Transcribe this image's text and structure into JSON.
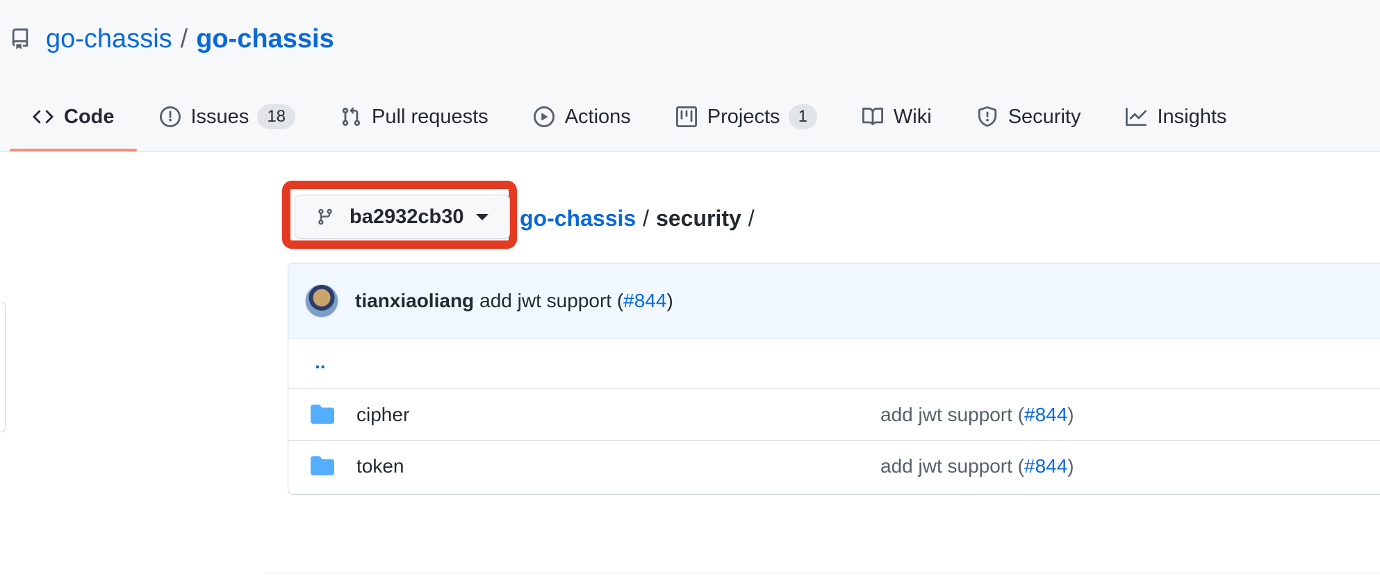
{
  "repo": {
    "owner": "go-chassis",
    "separator": "/",
    "name": "go-chassis"
  },
  "tabs": [
    {
      "label": "Code",
      "icon": "code-icon",
      "selected": true
    },
    {
      "label": "Issues",
      "icon": "issue-icon",
      "counter": "18"
    },
    {
      "label": "Pull requests",
      "icon": "pull-request-icon"
    },
    {
      "label": "Actions",
      "icon": "play-icon"
    },
    {
      "label": "Projects",
      "icon": "project-icon",
      "counter": "1"
    },
    {
      "label": "Wiki",
      "icon": "book-icon"
    },
    {
      "label": "Security",
      "icon": "shield-icon"
    },
    {
      "label": "Insights",
      "icon": "graph-icon"
    }
  ],
  "branch": {
    "label": "ba2932cb30",
    "highlight_color": "#e23b22"
  },
  "breadcrumb": {
    "root": "go-chassis",
    "sep1": "/",
    "current": "security",
    "sep2": "/"
  },
  "latest_commit": {
    "author": "tianxiaoliang",
    "message": "add jwt support (",
    "pr": "#844",
    "close": ")"
  },
  "files": {
    "parent_label": "..",
    "items": [
      {
        "name": "cipher",
        "type": "folder",
        "message": "add jwt support (",
        "pr": "#844",
        "close": ")"
      },
      {
        "name": "token",
        "type": "folder",
        "message": "add jwt support (",
        "pr": "#844",
        "close": ")"
      }
    ]
  },
  "colors": {
    "link": "#0969da",
    "folder": "#54aeff",
    "selected_tab_underline": "#fd8c73"
  }
}
